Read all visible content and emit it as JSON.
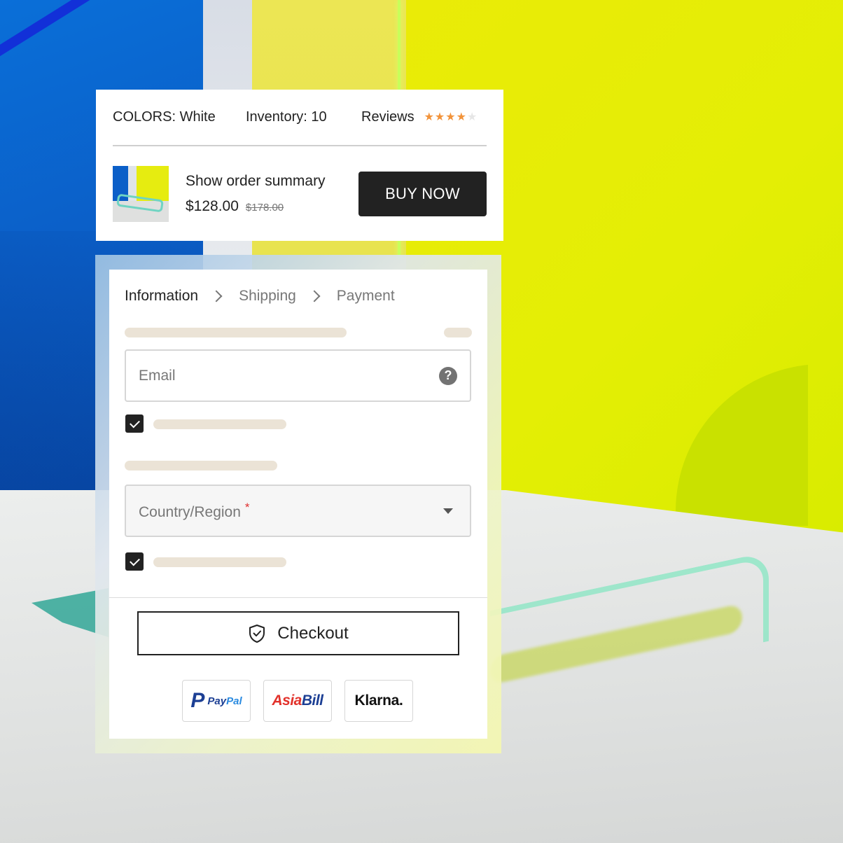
{
  "summary": {
    "colors": "COLORS: White",
    "inventory": "Inventory: 10",
    "reviews_label": "Reviews",
    "rating": 4,
    "rating_max": 5,
    "order_title": "Show order summary",
    "price": "$128.00",
    "original_price": "$178.00",
    "buy_label": "BUY NOW"
  },
  "checkout": {
    "steps": [
      "Information",
      "Shipping",
      "Payment"
    ],
    "email_placeholder": "Email",
    "help_glyph": "?",
    "country_placeholder": "Country/Region",
    "required_mark": "*",
    "newsletter_checked": true,
    "save_info_checked": true,
    "checkout_label": "Checkout",
    "payment_methods": {
      "paypal_mark": "P",
      "paypal_pay": "Pay",
      "paypal_pal": "Pal",
      "asiabill_a": "Asia",
      "asiabill_b": "Bill",
      "klarna": "Klarna."
    }
  },
  "icons": {
    "star": "star-icon",
    "help": "question-icon",
    "dropdown": "caret-down-icon",
    "checkbox": "check-icon",
    "checkout": "shield-check-icon",
    "step_separator": "chevron-right-icon"
  },
  "colors": {
    "star_filled": "#f2933a",
    "star_empty": "#e6e6e6",
    "buy_button": "#222222",
    "required": "#e03030",
    "skeleton": "#ebe3d6"
  }
}
